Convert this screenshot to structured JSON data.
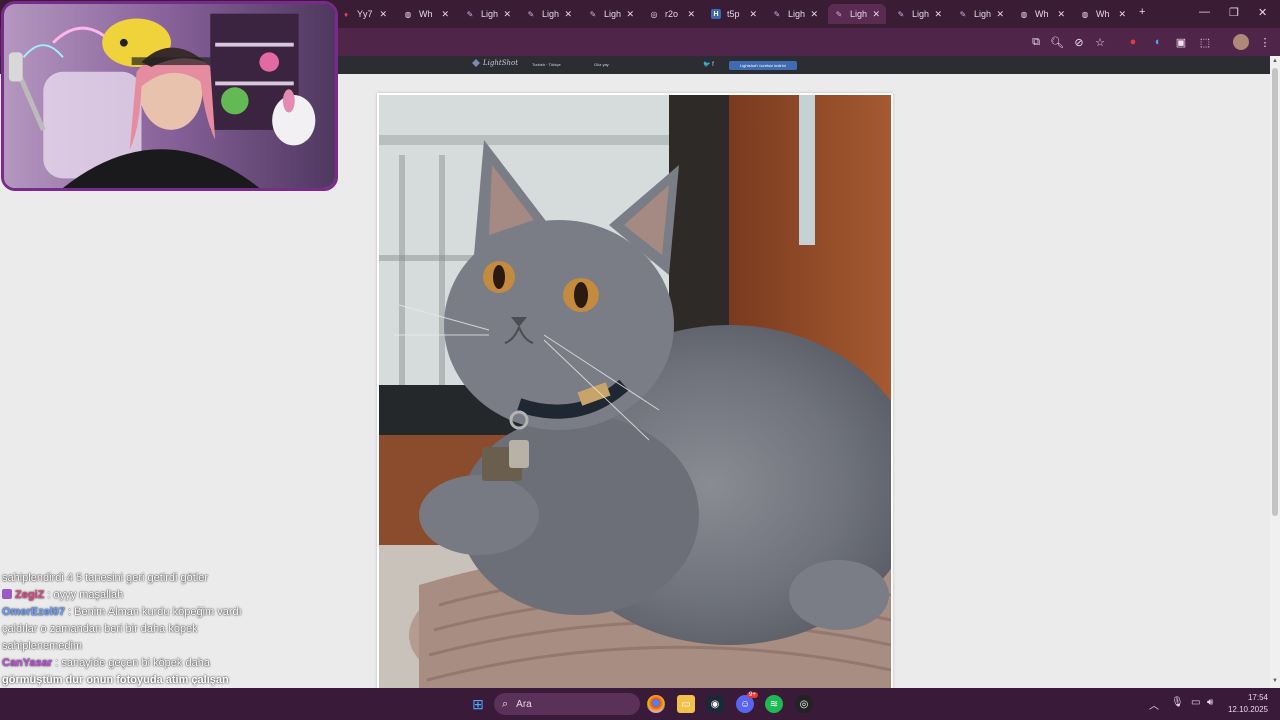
{
  "browser": {
    "tabs": [
      {
        "label": "Yy7",
        "favicon": "red-tab-icon",
        "active": false
      },
      {
        "label": "Wh",
        "favicon": "globe-icon",
        "active": false
      },
      {
        "label": "Ligh",
        "favicon": "feather-icon",
        "active": false
      },
      {
        "label": "Ligh",
        "favicon": "feather-icon",
        "active": false
      },
      {
        "label": "Ligh",
        "favicon": "feather-icon",
        "active": false
      },
      {
        "label": "r2o",
        "favicon": "circle-icon",
        "active": false
      },
      {
        "label": "t5p",
        "favicon": "h-badge-icon",
        "active": false
      },
      {
        "label": "Ligh",
        "favicon": "feather-icon",
        "active": false
      },
      {
        "label": "Ligh",
        "favicon": "feather-icon",
        "active": true
      },
      {
        "label": "Ligh",
        "favicon": "feather-icon",
        "active": false
      },
      {
        "label": "Ligh",
        "favicon": "feather-icon",
        "active": false
      },
      {
        "label": "Wh",
        "favicon": "globe-icon",
        "active": false
      },
      {
        "label": "Wh",
        "favicon": "globe-icon",
        "active": false
      }
    ],
    "new_tab": "+",
    "accent": "#4f2649"
  },
  "lightshot": {
    "logo_text": "LightShot",
    "nav_links": [
      "Turkish · Türkçe",
      "Göz yay"
    ],
    "social": "🐦 f",
    "promo_button": "Lightshot'ı ücretsiz indirin!"
  },
  "photo": {
    "subject": "gray kitten on knit basket by window"
  },
  "chat": {
    "lines": [
      {
        "user": "",
        "user_color": "",
        "text": "sahiplendirdi 4 5 tanesini geri getirdi götler"
      },
      {
        "user": "ZegiZ",
        "user_color": "#e04a8a",
        "text": ": oyyy maşallah",
        "badge": true
      },
      {
        "user": "OmerEzel07",
        "user_color": "#6aa0ff",
        "text": ": Benim Alman kurdu köpeğim vardı çaldılar o zamandan beri bir daha köpek sahiplenemedim"
      },
      {
        "user": "CanYasar",
        "user_color": "#c050e0",
        "text": ": sanayide geçen bi köpek daha"
      }
    ],
    "highlight": "görmüştüm dur onun fotoyuda atim çalışan emekçi köpke"
  },
  "taskbar": {
    "search_placeholder": "Ara",
    "clock_time": "17:54",
    "clock_date": "12.10.2025",
    "discord_badge": "9+"
  }
}
